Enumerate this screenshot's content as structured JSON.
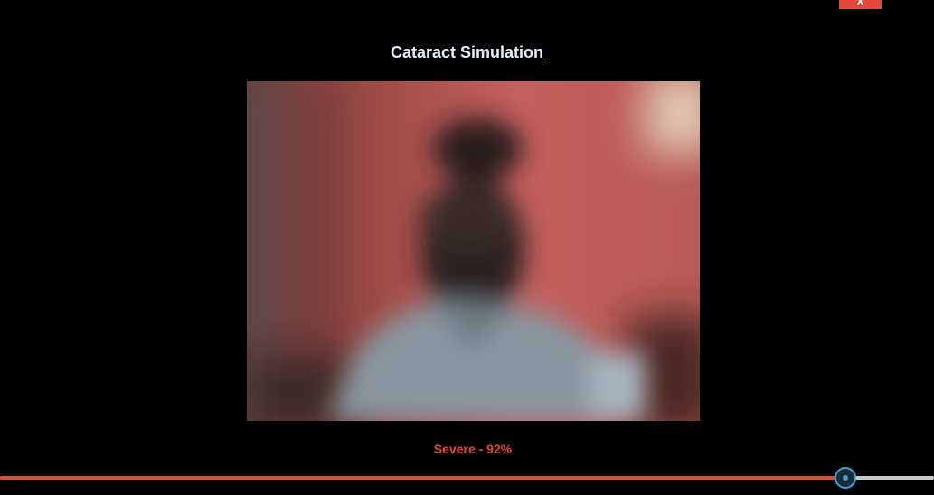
{
  "close_button": {
    "label": "x"
  },
  "title": "Cataract Simulation",
  "camera_feed": {
    "icon": "camera-feed-blurred-person",
    "blur_level": "severe"
  },
  "severity": {
    "text": "Severe - 92%",
    "value_percent": 92
  },
  "colors": {
    "accent": "#e2493b",
    "thumb": "#3fa5d8",
    "track": "#c4ccd2",
    "background": "#000000"
  }
}
